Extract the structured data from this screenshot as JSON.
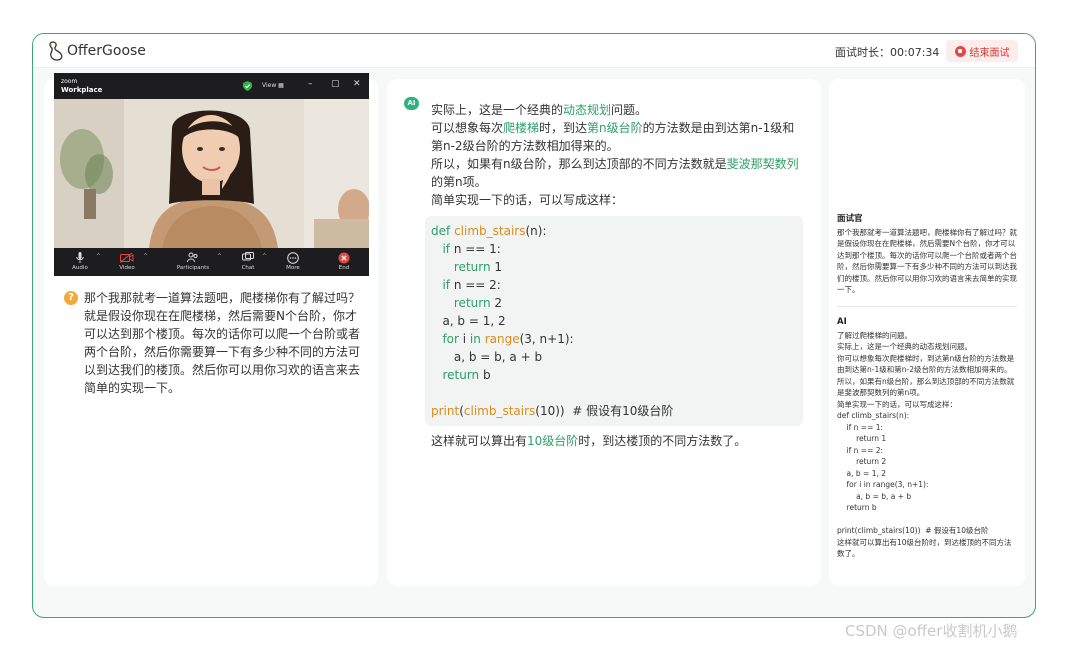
{
  "app": {
    "brand_name": "OfferGoose",
    "timer_label": "面试时长：",
    "timer_value": "00:07:34",
    "end_button": "结束面试",
    "accent_color": "#3aa876"
  },
  "zoom": {
    "brand_small": "zoom",
    "brand_big": "Workplace",
    "view_label": "View",
    "controls": [
      {
        "label": "Audio",
        "icon": "microphone-icon"
      },
      {
        "label": "Video",
        "icon": "video-off-icon"
      },
      {
        "label": "Participants",
        "icon": "participants-icon"
      },
      {
        "label": "Chat",
        "icon": "chat-icon"
      },
      {
        "label": "More",
        "icon": "more-icon"
      },
      {
        "label": "End",
        "icon": "end-call-icon"
      }
    ]
  },
  "question": {
    "badge": "?",
    "text": "那个我那就考一道算法题吧，爬楼梯你有了解过吗？就是假设你现在在爬楼梯，然后需要N个台阶，你才可以达到那个楼顶。每次的话你可以爬一个台阶或者两个台阶，然后你需要算一下有多少种不同的方法可以到达我们的楼顶。然后你可以用你习欢的语言来去简单的实现一下。"
  },
  "answer": {
    "badge": "AI",
    "p1_a": "实际上，这是一个经典的",
    "p1_hl": "动态规划",
    "p1_b": "问题。",
    "p2_a": "可以想象每次",
    "p2_hl1": "爬楼梯",
    "p2_b": "时，到达",
    "p2_hl2": "第n级台阶",
    "p2_c": "的方法数是由到达第n-1级和第n-2级台阶的方法数相加得来的。",
    "p3_a": "所以，如果有n级台阶，那么到达顶部的不同方法数就是",
    "p3_hl": "斐波那契数列",
    "p3_b": "的第n项。",
    "p4": "简单实现一下的话，可以写成这样：",
    "code": {
      "l1_kw": "def",
      "l1_fn": "climb_stairs",
      "l1_rest": "(n):",
      "l2_kw": "if",
      "l2_rest": " n == 1:",
      "l3_kw": "return",
      "l3_rest": " 1",
      "l4_kw": "if",
      "l4_rest": " n == 2:",
      "l5_kw": "return",
      "l5_rest": " 2",
      "l6": "a, b = 1, 2",
      "l7_kw": "for",
      "l7_a": " i ",
      "l7_kw2": "in",
      "l7_fn": " range",
      "l7_rest": "(3, n+1):",
      "l8": "a, b = b, a + b",
      "l9_kw": "return",
      "l9_rest": " b",
      "l10_fn": "print",
      "l10_fn2": "climb_stairs",
      "l10_rest": "(10))  # 假设有10级台阶",
      "l10_open": "("
    },
    "outro_a": "这样就可以算出有",
    "outro_hl": "10级台阶",
    "outro_b": "时，到达楼顶的不同方法数了。"
  },
  "history": {
    "interviewer_title": "面试官",
    "interviewer_text": "那个我那就考一道算法题吧，爬楼梯你有了解过吗？就是假设你现在在爬楼梯，然后需要N个台阶，你才可以达到那个楼顶。每次的话你可以爬一个台阶或者两个台阶，然后你需要算一下有多少种不同的方法可以到达我们的楼顶。然后你可以用你习欢的语言来去简单的实现一下。",
    "ai_title": "AI",
    "ai_lines": [
      "了解过爬楼梯的问题。",
      "实际上，这是一个经典的动态规划问题。",
      "你可以想象每次爬楼梯时，到达第n级台阶的方法数是由到达第n-1级和第n-2级台阶的方法数相加得来的。",
      "所以，如果有n级台阶，那么到达顶部的不同方法数就是斐波那契数列的第n项。",
      "简单实现一下的话，可以写成这样："
    ],
    "ai_code": [
      "def climb_stairs(n):",
      "    if n == 1:",
      "        return 1",
      "    if n == 2:",
      "        return 2",
      "    a, b = 1, 2",
      "    for i in range(3, n+1):",
      "        a, b = b, a + b",
      "    return b",
      "",
      "print(climb_stairs(10))  # 假设有10级台阶"
    ],
    "ai_outro": "这样就可以算出有10级台阶时，到达楼顶的不同方法数了。"
  },
  "watermark": "CSDN @offer收割机小鹅"
}
